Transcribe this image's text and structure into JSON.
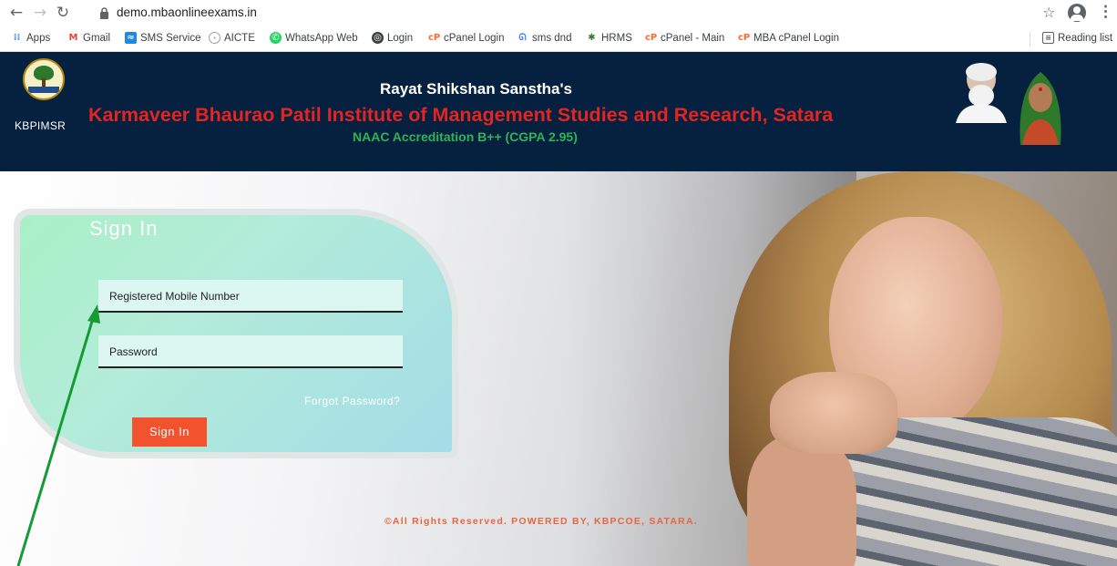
{
  "browser": {
    "url": "demo.mbaonlineexams.in",
    "bookmarks": [
      {
        "label": "Apps",
        "icon": "apps-grid-icon",
        "color": "#4285f4"
      },
      {
        "label": "Gmail",
        "icon": "gmail-icon",
        "color": "#ea4335"
      },
      {
        "label": "SMS Service",
        "icon": "sms-service-icon",
        "color": "#1e88e5"
      },
      {
        "label": "AICTE",
        "icon": "aicte-icon",
        "color": "#9e9e9e"
      },
      {
        "label": "WhatsApp Web",
        "icon": "whatsapp-icon",
        "color": "#25d366"
      },
      {
        "label": "Login",
        "icon": "login-globe-icon",
        "color": "#3c4043"
      },
      {
        "label": "cPanel Login",
        "icon": "cpanel-icon",
        "color": "#ff6c2c"
      },
      {
        "label": "sms dnd",
        "icon": "sms-dnd-icon",
        "color": "#4285f4"
      },
      {
        "label": "HRMS",
        "icon": "hrms-icon",
        "color": "#2e7d32"
      },
      {
        "label": "cPanel - Main",
        "icon": "cpanel-icon",
        "color": "#ff6c2c"
      },
      {
        "label": "MBA cPanel Login",
        "icon": "cpanel-icon",
        "color": "#ff6c2c"
      }
    ],
    "reading_list": "Reading list"
  },
  "header": {
    "logo_text": "KBPIMSR",
    "org": "Rayat Shikshan Sanstha's",
    "institute": "Karmaveer Bhaurao Patil Institute of Management Studies and Research, Satara",
    "accreditation": "NAAC Accreditation B++ (CGPA 2.95)"
  },
  "login": {
    "title": "Sign In",
    "mobile_placeholder": "Registered Mobile Number",
    "password_placeholder": "Password",
    "forgot": "Forgot Password?",
    "submit": "Sign In"
  },
  "footer": {
    "text": "©All Rights Reserved. POWERED BY, KBPCOE, SATARA."
  },
  "colors": {
    "header_bg": "#05213f",
    "institute_red": "#e32521",
    "naac_green": "#2fb356",
    "button": "#f2522e",
    "annotation_arrow": "#159a35"
  }
}
